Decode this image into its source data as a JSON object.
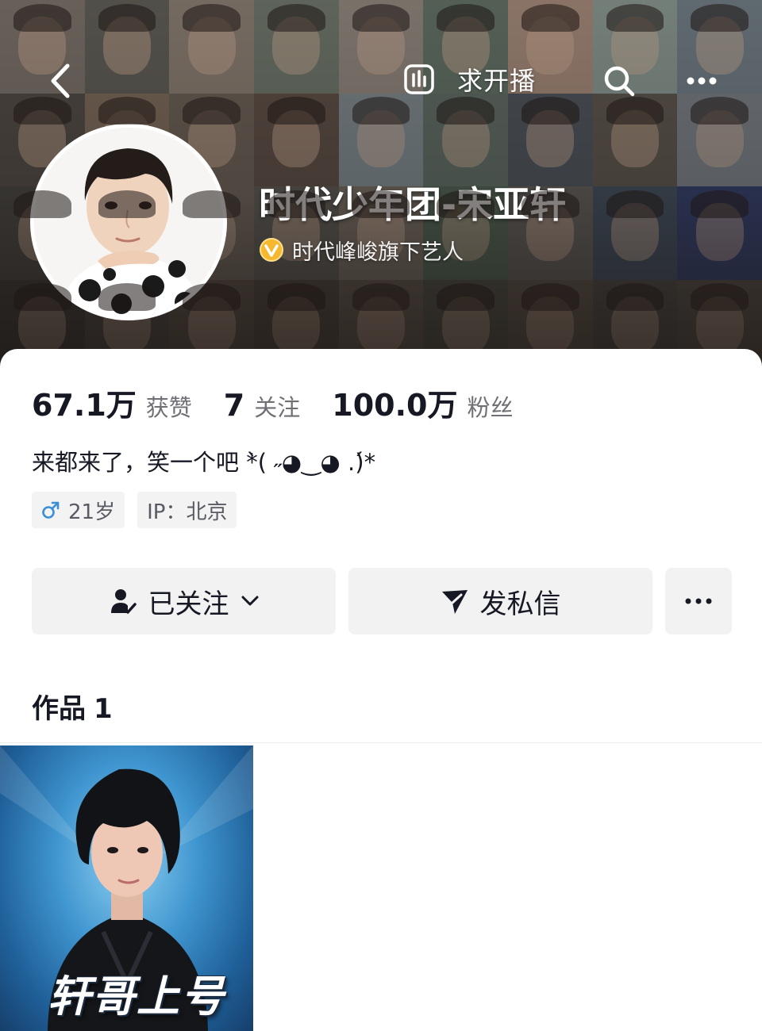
{
  "header": {
    "live_request_label": "求开播",
    "nickname": "时代少年团-宋亚轩",
    "verification": "时代峰峻旗下艺人",
    "icons": {
      "back": "back-arrow-icon",
      "live_chart": "bar-chart-icon",
      "search": "search-icon",
      "more": "more-horizontal-icon",
      "verified": "verified-badge-icon"
    }
  },
  "stats": [
    {
      "value": "67.1万",
      "label": "获赞"
    },
    {
      "value": "7",
      "label": "关注"
    },
    {
      "value": "100.0万",
      "label": "粉丝"
    }
  ],
  "bio": "来都来了，笑一个吧 *̀( ˶◕‿◕ .)́*",
  "tags": {
    "gender_age": "21岁",
    "ip": "IP：北京"
  },
  "actions": {
    "follow_label": "已关注",
    "message_label": "发私信"
  },
  "works": {
    "title": "作品",
    "count": "1",
    "items": [
      {
        "caption": "轩哥上号"
      }
    ]
  },
  "colors": {
    "verified_badge": "#f5b82e",
    "male_icon": "#3a8fd6",
    "button_bg": "#f2f2f3",
    "text_primary": "#161823",
    "text_secondary": "#6f7076"
  }
}
